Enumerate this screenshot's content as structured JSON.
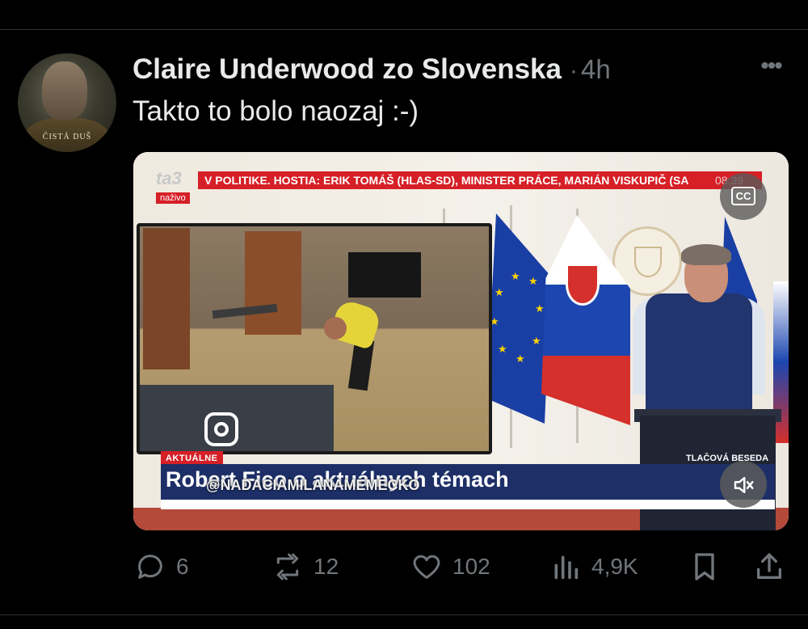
{
  "tweet": {
    "author": "Claire Underwood zo Slovenska",
    "separator": "·",
    "time": "4h",
    "text": "Takto to bolo naozaj :-)",
    "avatar_caption": "ČISTÁ DUŠ",
    "more_label": "•••"
  },
  "media": {
    "channel_logo": "ta3",
    "live_badge": "naživo",
    "ticker_text": "V POLITIKE. HOSTIA: ERIK TOMÁŠ (HLAS-SD), MINISTER PRÁCE, MARIÁN VISKUPIČ (SA",
    "ticker_clock": "08:39",
    "cc_label": "CC",
    "tag_left": "AKTUÁLNE",
    "tag_right": "TLAČOVÁ BESEDA",
    "headline": "Robert Fico o aktuálnych témach",
    "watermark": "@NADACIAMILANAMEMECKO",
    "mute_icon": "speaker-muted-icon"
  },
  "actions": {
    "replies": "6",
    "reposts": "12",
    "likes": "102",
    "views": "4,9K"
  },
  "colors": {
    "background": "#000000",
    "primary_text": "#e7e9ea",
    "secondary_text": "#71767b",
    "divider": "#2f3336",
    "news_red": "#d61f26",
    "news_blue": "#1d2f66"
  }
}
